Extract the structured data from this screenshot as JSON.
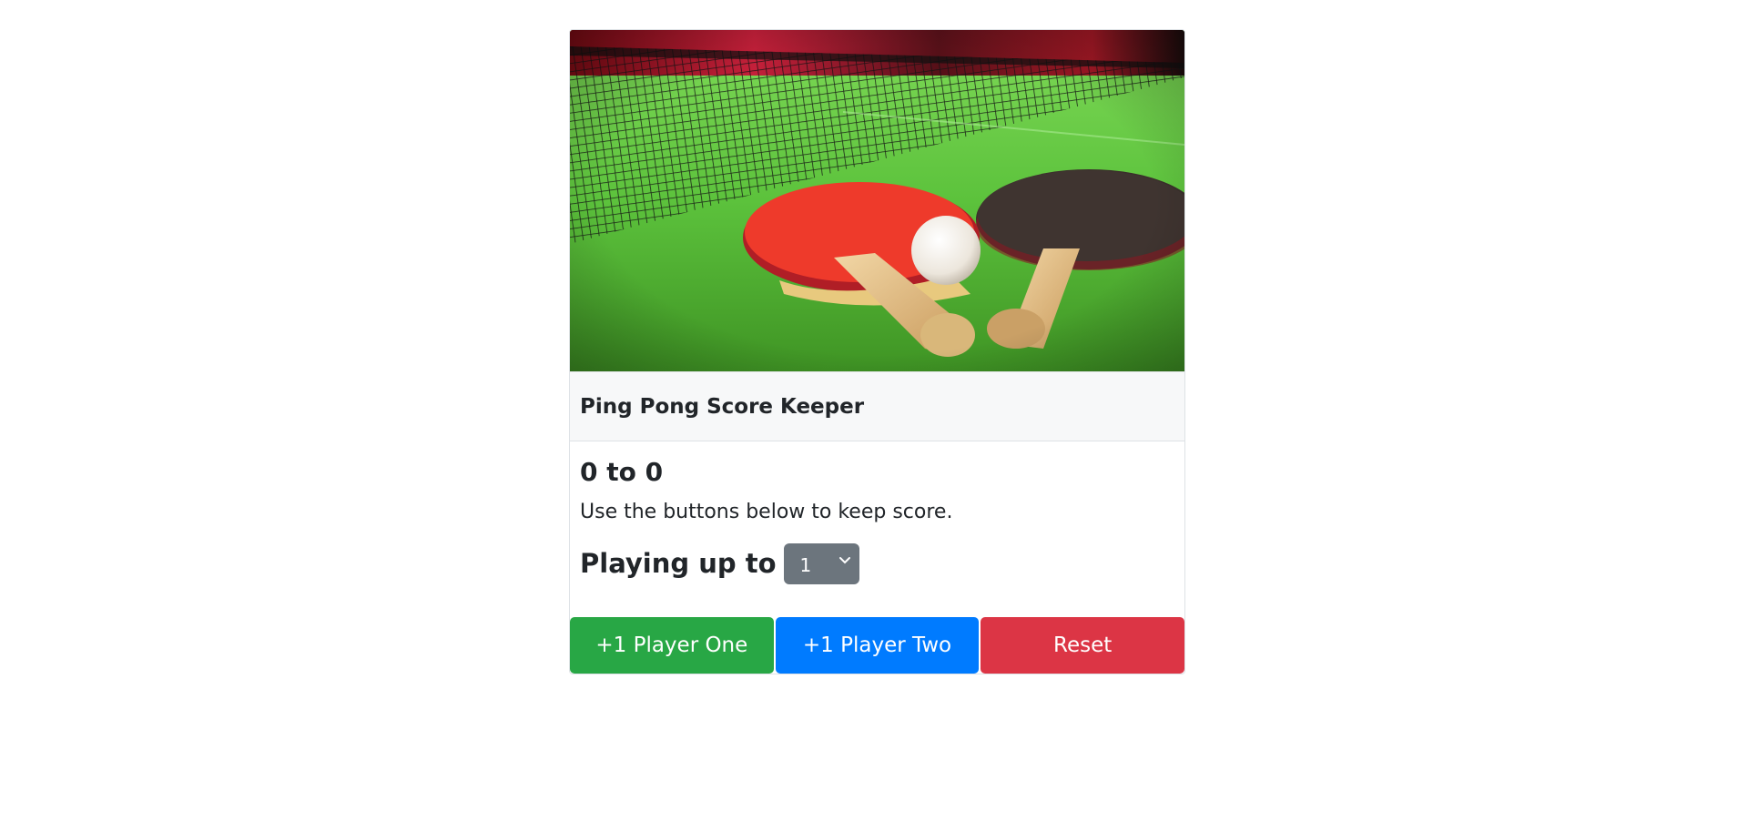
{
  "app": {
    "header_title": "Ping Pong Score Keeper",
    "score_display": "0 to 0",
    "hint": "Use the buttons below to keep score.",
    "playing_label": "Playing up to",
    "winning_score_selected": "1"
  },
  "buttons": {
    "player_one": "+1 Player One",
    "player_two": "+1 Player Two",
    "reset": "Reset"
  },
  "colors": {
    "player_one": "#28a745",
    "player_two": "#007bff",
    "reset": "#dc3545",
    "select": "#6c757d"
  }
}
